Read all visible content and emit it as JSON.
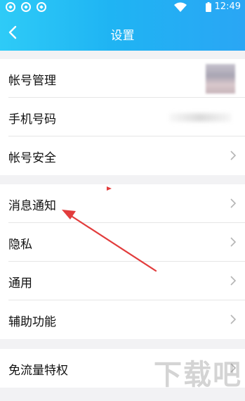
{
  "status_bar": {
    "time": "12:49",
    "icons": [
      "notification-icon",
      "notification-icon",
      "notification-icon",
      "wifi-icon",
      "battery-icon"
    ]
  },
  "header": {
    "title": "设置",
    "back_icon": "back-arrow-icon"
  },
  "settings": {
    "items": [
      {
        "label": "帐号管理",
        "trailing": "avatar"
      },
      {
        "label": "手机号码",
        "trailing": "masked-phone"
      },
      {
        "label": "帐号安全",
        "trailing": "chevron-right-icon"
      },
      {
        "label": "消息通知",
        "trailing": "chevron-right-icon"
      },
      {
        "label": "隐私",
        "trailing": "chevron-right-icon"
      },
      {
        "label": "通用",
        "trailing": "chevron-right-icon"
      },
      {
        "label": "辅助功能",
        "trailing": "chevron-right-icon"
      },
      {
        "label": "免流量特权",
        "trailing": "chevron-right-icon"
      }
    ]
  },
  "annotation": {
    "color": "#e23c3c"
  },
  "watermark": {
    "text": "下载吧"
  },
  "colors": {
    "header_start": "#2ecbf7",
    "header_end": "#2aa6f4",
    "background": "#f2f2f4"
  }
}
